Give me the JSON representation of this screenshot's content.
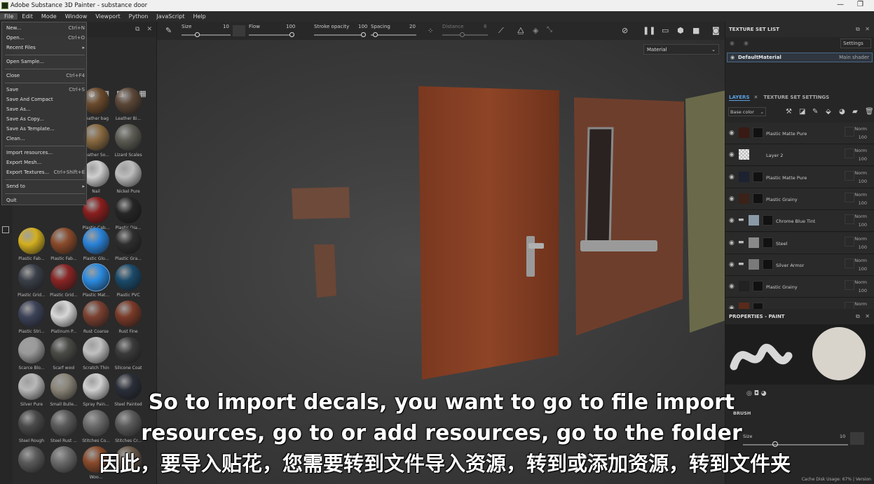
{
  "window": {
    "title": "Adobe Substance 3D Painter - substance door"
  },
  "menubar": [
    "File",
    "Edit",
    "Mode",
    "Window",
    "Viewport",
    "Python",
    "JavaScript",
    "Help"
  ],
  "file_menu": [
    {
      "label": "New...",
      "shortcut": "Ctrl+N"
    },
    {
      "label": "Open...",
      "shortcut": "Ctrl+O"
    },
    {
      "label": "Recent Files",
      "shortcut": "▸"
    },
    {
      "label": "Open Sample...",
      "shortcut": ""
    },
    {
      "label": "Close",
      "shortcut": "Ctrl+F4"
    },
    {
      "label": "Save",
      "shortcut": "Ctrl+S"
    },
    {
      "label": "Save And Compact",
      "shortcut": ""
    },
    {
      "label": "Save As...",
      "shortcut": ""
    },
    {
      "label": "Save As Copy...",
      "shortcut": ""
    },
    {
      "label": "Save As Template...",
      "shortcut": ""
    },
    {
      "label": "Clean...",
      "shortcut": ""
    },
    {
      "label": "Import resources...",
      "shortcut": ""
    },
    {
      "label": "Export Mesh...",
      "shortcut": ""
    },
    {
      "label": "Export Textures...",
      "shortcut": "Ctrl+Shift+E"
    },
    {
      "label": "Send to",
      "shortcut": "▸"
    },
    {
      "label": "Quit",
      "shortcut": ""
    }
  ],
  "materials": [
    {
      "label": "Leather bag",
      "color": "#6b4a2c"
    },
    {
      "label": "Leather Bi...",
      "color": "#5a4636"
    },
    {
      "label": "Leather So...",
      "color": "#8a6a40"
    },
    {
      "label": "Lizard Scales",
      "color": "#5c5c54"
    },
    {
      "label": "Nail",
      "color": "#cfcfcf"
    },
    {
      "label": "Nickel Pure",
      "color": "#bdbdbd"
    },
    {
      "label": "Plastic Cab...",
      "color": "#8a1e1e"
    },
    {
      "label": "Plastic Dia...",
      "color": "#262626"
    },
    {
      "label": "Plastic Fab...",
      "color": "#d4b020"
    },
    {
      "label": "Plastic Fab...",
      "color": "#8a4a2a"
    },
    {
      "label": "Plastic Glo...",
      "color": "#2a82d8"
    },
    {
      "label": "Plastic Gra...",
      "color": "#2e2e2e"
    },
    {
      "label": "Plastic Grid...",
      "color": "#3a3f48"
    },
    {
      "label": "Plastic Grid...",
      "color": "#8a2424"
    },
    {
      "label": "Plastic Mat...",
      "color": "#2a8ae0"
    },
    {
      "label": "Plastic PVC",
      "color": "#1a4a6a"
    },
    {
      "label": "Plastic Stri...",
      "color": "#3c4258"
    },
    {
      "label": "Platinum P...",
      "color": "#d8d8d8"
    },
    {
      "label": "Rust Coarse",
      "color": "#7a4030"
    },
    {
      "label": "Rust Fine",
      "color": "#7a3a28"
    },
    {
      "label": "Scarce Blo...",
      "color": "#9a9a9a"
    },
    {
      "label": "Scarf wool",
      "color": "#4a4a46"
    },
    {
      "label": "Scratch Thin",
      "color": "#c0c0c0"
    },
    {
      "label": "Silicone Coat",
      "color": "#3a3a3a"
    },
    {
      "label": "Silver Pure",
      "color": "#b8b8b8"
    },
    {
      "label": "Small Bulle...",
      "color": "#8a8578"
    },
    {
      "label": "Spray Pain...",
      "color": "#d0d0d0"
    },
    {
      "label": "Steel Painted",
      "color": "#2a2e38"
    },
    {
      "label": "Steel Rough",
      "color": "#4a4a4a"
    },
    {
      "label": "Steel Rust ...",
      "color": "#5a5a5a"
    },
    {
      "label": "Stitches Co...",
      "color": "#6a6a6a"
    },
    {
      "label": "Stitches Cr...",
      "color": "#5a5a5a"
    },
    {
      "label": "",
      "color": "#5a5a5a"
    },
    {
      "label": "",
      "color": "#6a6a6a"
    },
    {
      "label": "Woo...",
      "color": "#8a4a2a"
    },
    {
      "label": "",
      "color": "#6a5a4a"
    }
  ],
  "toolbar": {
    "size_label": "Size",
    "size_value": "10",
    "flow_label": "Flow",
    "flow_value": "100",
    "stroke_label": "Stroke opacity",
    "stroke_value": "100",
    "spacing_label": "Spacing",
    "spacing_value": "20",
    "distance_label": "Distance",
    "distance_value": "8"
  },
  "viewport": {
    "material_select": "Material"
  },
  "texture_set_list": {
    "title": "TEXTURE SET LIST",
    "settings": "Settings",
    "item": "DefaultMaterial",
    "shader": "Main shader"
  },
  "layers": {
    "tab1": "LAYERS",
    "tab2": "TEXTURE SET SETTINGS",
    "channel": "Base color",
    "rows": [
      {
        "name": "Plastic Matte Pure",
        "blend": "Norm",
        "opacity": "100",
        "thumb": "#3a1a14",
        "mask": "#111",
        "folder": false
      },
      {
        "name": "Layer 2",
        "blend": "Norm",
        "opacity": "100",
        "thumb": "#cfcfcf",
        "mask": "",
        "folder": false
      },
      {
        "name": "Plastic Matte Pure",
        "blend": "Norm",
        "opacity": "100",
        "thumb": "#1c2230",
        "mask": "#111",
        "folder": false
      },
      {
        "name": "Plastic Grainy",
        "blend": "Norm",
        "opacity": "100",
        "thumb": "#3a2218",
        "mask": "#111",
        "folder": false
      },
      {
        "name": "Chrome Blue Tint",
        "blend": "Norm",
        "opacity": "100",
        "thumb": "#8a9aa6",
        "mask": "#111",
        "folder": true
      },
      {
        "name": "Steel",
        "blend": "Norm",
        "opacity": "100",
        "thumb": "#8a8a8a",
        "mask": "#111",
        "folder": true
      },
      {
        "name": "Silver Armor",
        "blend": "Norm",
        "opacity": "100",
        "thumb": "#7a7a7a",
        "mask": "#111",
        "folder": true
      },
      {
        "name": "Plastic Grainy",
        "blend": "Norm",
        "opacity": "100",
        "thumb": "#222",
        "mask": "#111",
        "folder": false
      },
      {
        "name": "",
        "blend": "Norm",
        "opacity": "",
        "thumb": "#5a2a1a",
        "mask": "#111",
        "folder": false
      }
    ]
  },
  "properties": {
    "title": "PROPERTIES - PAINT",
    "brush": "BRUSH",
    "size_label": "Size",
    "size_value": "10"
  },
  "status": {
    "cache": "Cache Disk Usage:",
    "cache_value": "67%",
    "version": "Version"
  },
  "subtitles": {
    "en": "So to import decals, you want to go to file import resources, go to or add resources, go to the folder",
    "cn": "因此，要导入贴花，您需要转到文件导入资源，转到或添加资源，转到文件夹"
  }
}
